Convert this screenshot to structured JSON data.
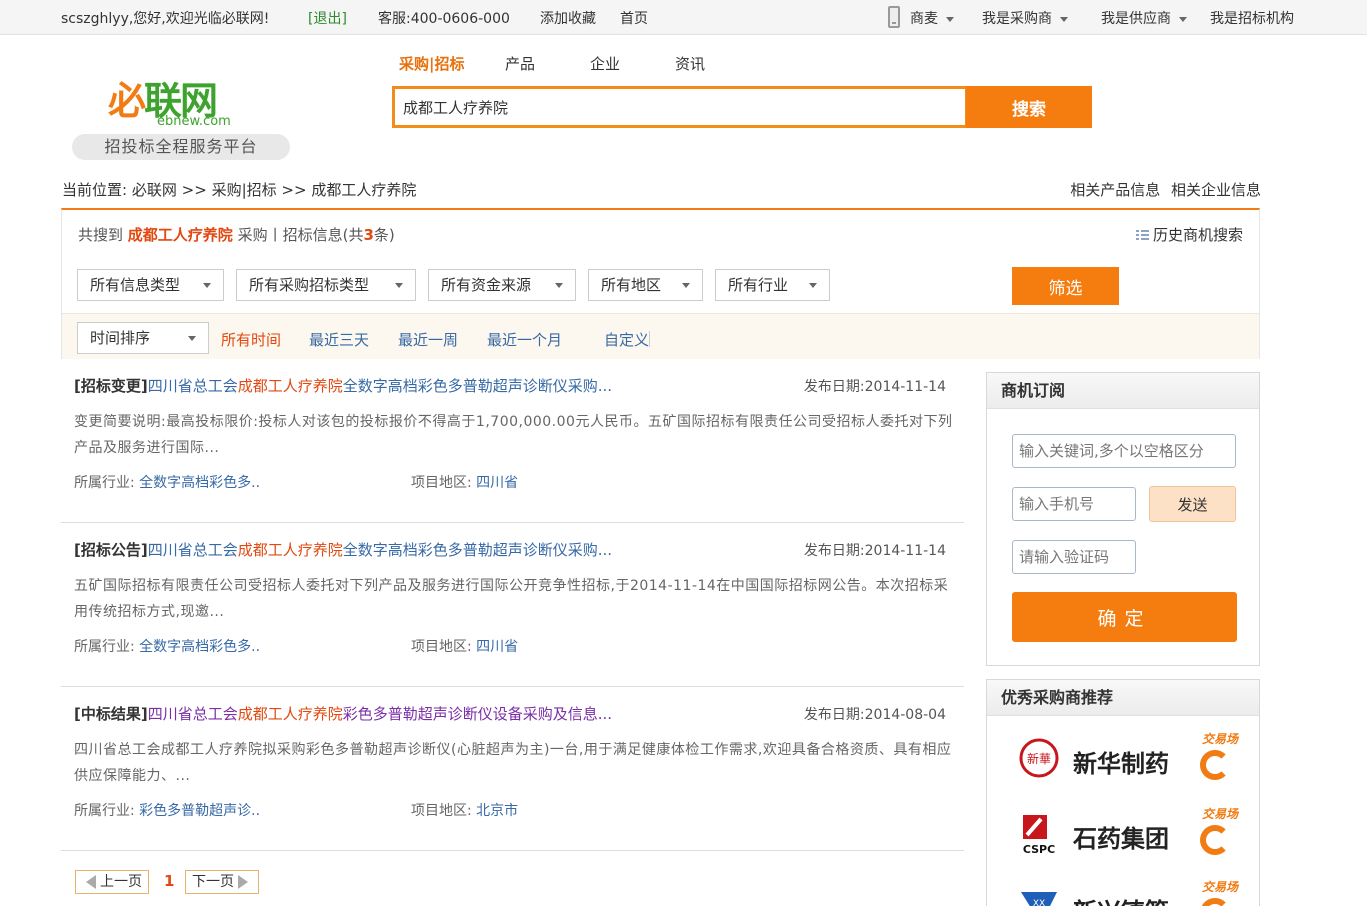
{
  "topbar": {
    "greeting": "scszghlyy,您好,欢迎光临必联网!",
    "logout": "[退出]",
    "service": "客服:400-0606-000",
    "favorite": "添加收藏",
    "home": "首页",
    "menus": [
      "商麦",
      "我是采购商",
      "我是供应商",
      "我是招标机构"
    ]
  },
  "logo": {
    "mark_a": "必",
    "mark_b": "联网",
    "sub": "ebnew.com",
    "tagline": "招投标全程服务平台"
  },
  "search": {
    "tabs": [
      "采购|招标",
      "产品",
      "企业",
      "资讯"
    ],
    "value": "成都工人疗养院",
    "button": "搜索"
  },
  "breadcrumb": {
    "prefix": "当前位置:",
    "items": [
      "必联网",
      "采购|招标",
      "成都工人疗养院"
    ],
    "sep": ">>",
    "right": [
      "相关产品信息",
      "相关企业信息"
    ]
  },
  "filters": {
    "summary_prefix": "共搜到",
    "keyword": "成都工人疗养院",
    "summary_mid": "采购丨招标信息(共",
    "count": "3",
    "summary_suffix": "条)",
    "history": "历史商机搜索",
    "selects": [
      "所有信息类型",
      "所有采购招标类型",
      "所有资金来源",
      "所有地区",
      "所有行业"
    ],
    "button": "筛选",
    "time_sort": "时间排序",
    "time_options": [
      "所有时间",
      "最近三天",
      "最近一周",
      "最近一个月",
      "自定义"
    ]
  },
  "results": [
    {
      "type": "[招标变更]",
      "title_a": "四川省总工会",
      "title_hl": "成都工人疗养院",
      "title_b": "全数字高档彩色多普勒超声诊断仪采购...",
      "date_label": "发布日期:",
      "date": "2014-11-14",
      "desc": "变更简要说明:最高投标限价:投标人对该包的投标报价不得高于1,700,000.00元人民币。五矿国际招标有限责任公司受招标人委托对下列产品及服务进行国际...",
      "industry_label": "所属行业:",
      "industry": "全数字高档彩色多..",
      "region_label": "项目地区:",
      "region": "四川省"
    },
    {
      "type": "[招标公告]",
      "title_a": "四川省总工会",
      "title_hl": "成都工人疗养院",
      "title_b": "全数字高档彩色多普勒超声诊断仪采购...",
      "date_label": "发布日期:",
      "date": "2014-11-14",
      "desc": "五矿国际招标有限责任公司受招标人委托对下列产品及服务进行国际公开竞争性招标,于2014-11-14在中国国际招标网公告。本次招标采用传统招标方式,现邀...",
      "industry_label": "所属行业:",
      "industry": "全数字高档彩色多..",
      "region_label": "项目地区:",
      "region": "四川省"
    },
    {
      "type": "[中标结果]",
      "title_a": "四川省总工会",
      "title_hl": "成都工人疗养院",
      "title_b": "彩色多普勒超声诊断仪设备采购及信息...",
      "date_label": "发布日期:",
      "date": "2014-08-04",
      "desc": "四川省总工会成都工人疗养院拟采购彩色多普勒超声诊断仪(心脏超声为主)一台,用于满足健康体检工作需求,欢迎具备合格资质、具有相应供应保障能力、...",
      "industry_label": "所属行业:",
      "industry": "彩色多普勒超声诊..",
      "region_label": "项目地区:",
      "region": "北京市"
    }
  ],
  "pager": {
    "prev": "上一页",
    "page": "1",
    "next": "下一页"
  },
  "subscribe": {
    "title": "商机订阅",
    "keyword_placeholder": "输入关键词,多个以空格区分",
    "phone_placeholder": "输入手机号",
    "send": "发送",
    "code_placeholder": "请输入验证码",
    "confirm": "确定"
  },
  "recommend": {
    "title": "优秀采购商推荐",
    "tag": "交易场",
    "items": [
      {
        "name": "新华制药",
        "logo_text": "新華",
        "color": "#c8161d"
      },
      {
        "name": "石药集团",
        "logo_text": "CSPC",
        "color": "#c8161d"
      },
      {
        "name": "新兴铸管",
        "logo_text": "XX",
        "color": "#1f5fb8"
      }
    ]
  }
}
